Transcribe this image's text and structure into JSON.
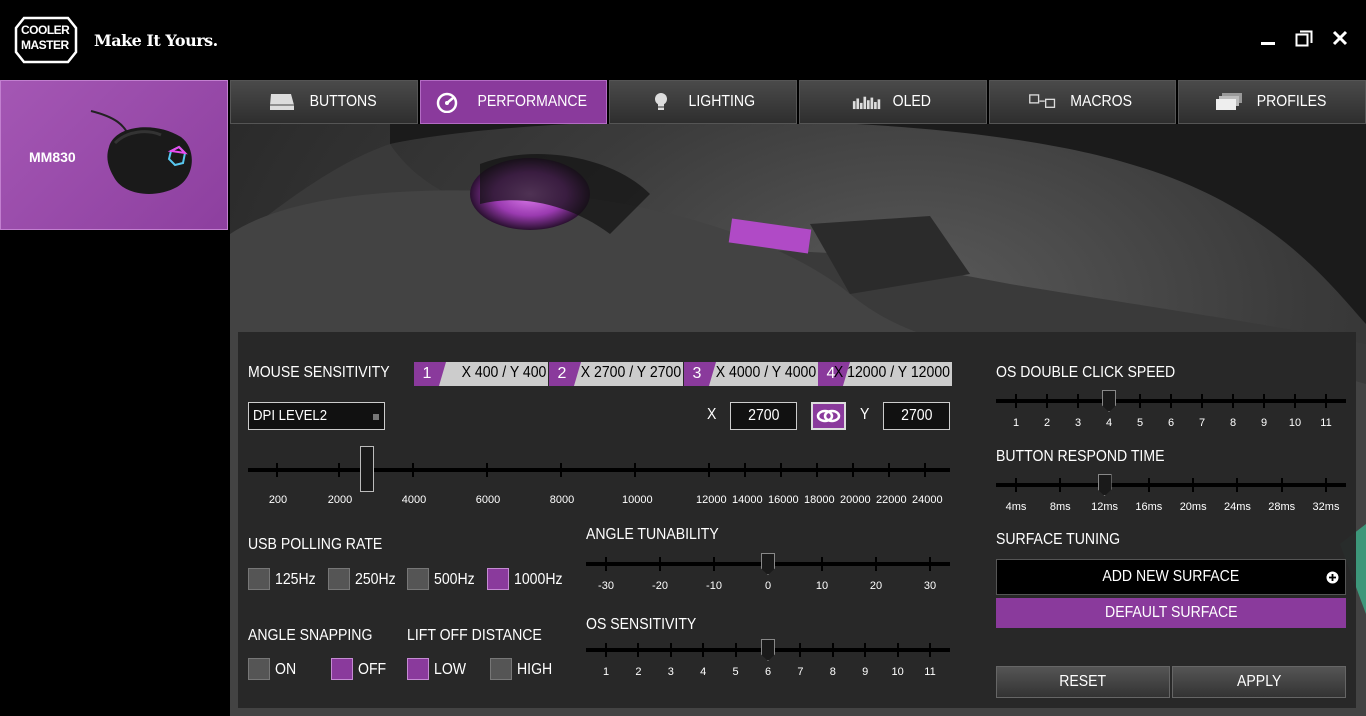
{
  "app": {
    "logo_line1": "COOLER",
    "logo_line2": "MASTER",
    "tagline": "Make It Yours."
  },
  "device": {
    "name": "MM830"
  },
  "tabs": [
    {
      "label": "BUTTONS",
      "icon": "keycap-icon"
    },
    {
      "label": "PERFORMANCE",
      "icon": "gauge-icon"
    },
    {
      "label": "LIGHTING",
      "icon": "bulb-icon"
    },
    {
      "label": "OLED",
      "icon": "equalizer-icon"
    },
    {
      "label": "MACROS",
      "icon": "macro-keys-icon"
    },
    {
      "label": "PROFILES",
      "icon": "stack-icon"
    }
  ],
  "active_tab": "PERFORMANCE",
  "sensitivity": {
    "label": "MOUSE SENSITIVITY",
    "levels": [
      {
        "num": "1",
        "value": "X 400 / Y 400"
      },
      {
        "num": "2",
        "value": "X 2700 / Y 2700"
      },
      {
        "num": "3",
        "value": "X 4000 / Y 4000"
      },
      {
        "num": "4",
        "value": "X 12000 / Y 12000"
      }
    ],
    "dpi_select": "DPI LEVEL2",
    "x_label": "X",
    "x_value": "2700",
    "y_label": "Y",
    "y_value": "2700",
    "slider_value": 2700,
    "ticks": [
      "200",
      "2000",
      "4000",
      "6000",
      "8000",
      "10000",
      "12000",
      "14000",
      "16000",
      "18000",
      "20000",
      "22000",
      "24000"
    ]
  },
  "usb_polling": {
    "label": "USB POLLING RATE",
    "options": [
      {
        "label": "125Hz",
        "checked": false
      },
      {
        "label": "250Hz",
        "checked": false
      },
      {
        "label": "500Hz",
        "checked": false
      },
      {
        "label": "1000Hz",
        "checked": true
      }
    ]
  },
  "angle_snapping": {
    "label": "ANGLE SNAPPING",
    "on": "ON",
    "off": "OFF",
    "selected": "OFF"
  },
  "lift_off": {
    "label": "LIFT OFF DISTANCE",
    "low": "LOW",
    "high": "HIGH",
    "selected": "LOW"
  },
  "angle_tunability": {
    "label": "ANGLE TUNABILITY",
    "ticks": [
      "-30",
      "-20",
      "-10",
      "0",
      "10",
      "20",
      "30"
    ],
    "value": 0
  },
  "os_sensitivity": {
    "label": "OS SENSITIVITY",
    "ticks": [
      "1",
      "2",
      "3",
      "4",
      "5",
      "6",
      "7",
      "8",
      "9",
      "10",
      "11"
    ],
    "value": 6
  },
  "os_double_click": {
    "label": "OS DOUBLE CLICK SPEED",
    "ticks": [
      "1",
      "2",
      "3",
      "4",
      "5",
      "6",
      "7",
      "8",
      "9",
      "10",
      "11"
    ],
    "value": 4
  },
  "button_respond": {
    "label": "BUTTON RESPOND TIME",
    "ticks": [
      "4ms",
      "8ms",
      "12ms",
      "16ms",
      "20ms",
      "24ms",
      "28ms",
      "32ms"
    ],
    "value": "12ms"
  },
  "surface": {
    "label": "SURFACE TUNING",
    "add": "ADD NEW SURFACE",
    "default": "DEFAULT SURFACE"
  },
  "actions": {
    "reset": "RESET",
    "apply": "APPLY"
  },
  "colors": {
    "accent": "#8a3a9c",
    "panel": "#282828"
  }
}
